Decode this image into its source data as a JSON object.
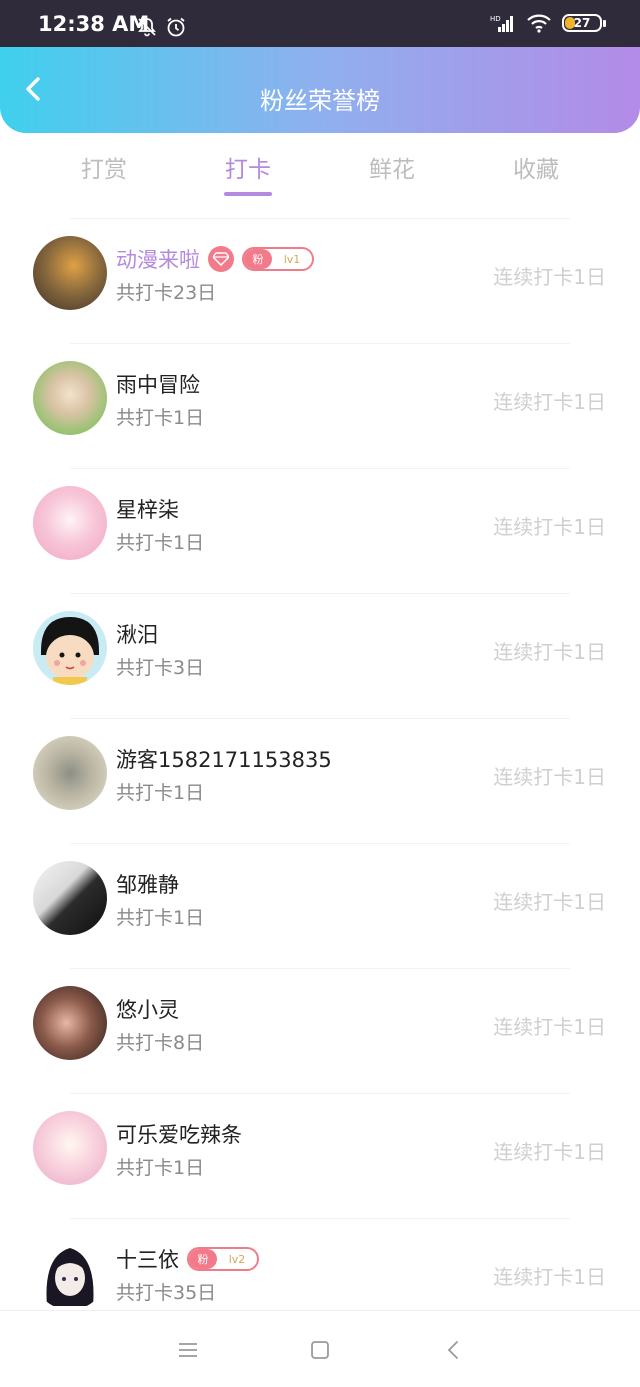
{
  "status": {
    "time": "12:38 AM",
    "battery": "27"
  },
  "header": {
    "title": "粉丝荣誉榜"
  },
  "tabs": [
    {
      "label": "打赏",
      "active": false
    },
    {
      "label": "打卡",
      "active": true
    },
    {
      "label": "鲜花",
      "active": false
    },
    {
      "label": "收藏",
      "active": false
    }
  ],
  "list": [
    {
      "name": "动漫来啦",
      "count": "共打卡23日",
      "streak": "连续打卡1日",
      "vip": true,
      "fan_label": "粉",
      "level": "lv1"
    },
    {
      "name": "雨中冒险",
      "count": "共打卡1日",
      "streak": "连续打卡1日"
    },
    {
      "name": "星梓柒",
      "count": "共打卡1日",
      "streak": "连续打卡1日"
    },
    {
      "name": "湫汨",
      "count": "共打卡3日",
      "streak": "连续打卡1日"
    },
    {
      "name": "游客1582171153835",
      "count": "共打卡1日",
      "streak": "连续打卡1日"
    },
    {
      "name": "邹雅静",
      "count": "共打卡1日",
      "streak": "连续打卡1日"
    },
    {
      "name": "悠小灵",
      "count": "共打卡8日",
      "streak": "连续打卡1日"
    },
    {
      "name": "可乐爱吃辣条",
      "count": "共打卡1日",
      "streak": "连续打卡1日"
    },
    {
      "name": "十三依",
      "count": "共打卡35日",
      "streak": "连续打卡1日",
      "fan_label": "粉",
      "level": "lv2"
    }
  ],
  "colors": {
    "accent": "#b48ae0",
    "badge": "#f27b8b"
  }
}
